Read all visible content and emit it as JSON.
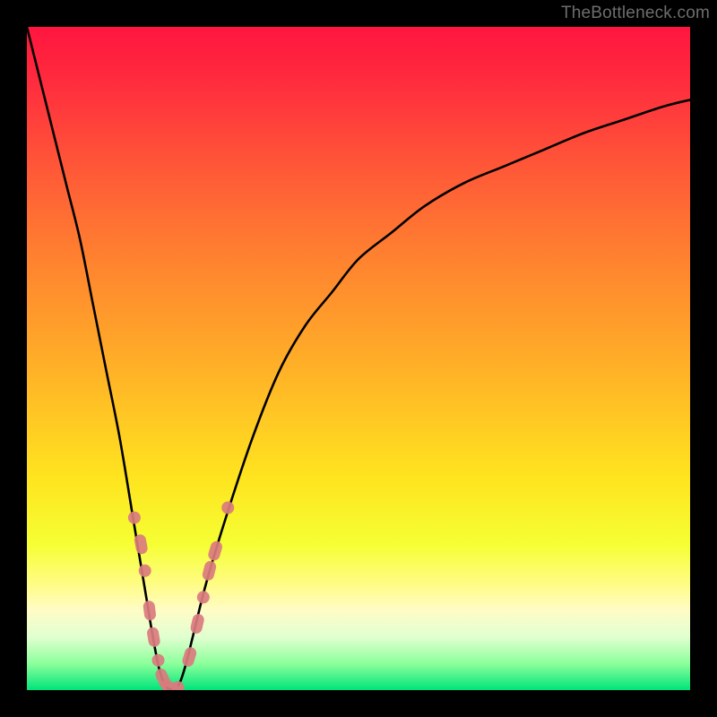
{
  "watermark": "TheBottleneck.com",
  "chart_data": {
    "type": "line",
    "title": "",
    "xlabel": "",
    "ylabel": "",
    "xlim": [
      0,
      100
    ],
    "ylim": [
      0,
      100
    ],
    "grid": false,
    "series": [
      {
        "name": "bottleneck-curve",
        "x": [
          0,
          2,
          4,
          6,
          8,
          10,
          12,
          14,
          16,
          17,
          18,
          19,
          20,
          21,
          22,
          23,
          24,
          25,
          27,
          30,
          34,
          38,
          42,
          46,
          50,
          55,
          60,
          66,
          72,
          78,
          84,
          90,
          96,
          100
        ],
        "y": [
          100,
          92,
          84,
          76,
          68,
          58,
          48,
          38,
          26,
          20,
          14,
          8,
          3,
          0.5,
          0.2,
          1,
          4,
          8,
          16,
          26,
          38,
          48,
          55,
          60,
          65,
          69,
          73,
          76.5,
          79,
          81.5,
          84,
          86,
          88,
          89
        ]
      }
    ],
    "scatter_points": {
      "name": "highlighted-points",
      "points": [
        {
          "x": 16.2,
          "y": 26.0
        },
        {
          "x": 17.2,
          "y": 22.0
        },
        {
          "x": 17.8,
          "y": 18.0
        },
        {
          "x": 18.5,
          "y": 12.0
        },
        {
          "x": 19.1,
          "y": 8.0
        },
        {
          "x": 19.8,
          "y": 4.5
        },
        {
          "x": 20.5,
          "y": 1.8
        },
        {
          "x": 21.6,
          "y": 0.4
        },
        {
          "x": 22.8,
          "y": 0.4
        },
        {
          "x": 24.5,
          "y": 5.0
        },
        {
          "x": 25.7,
          "y": 10.0
        },
        {
          "x": 26.6,
          "y": 14.0
        },
        {
          "x": 27.5,
          "y": 18.0
        },
        {
          "x": 28.4,
          "y": 21.0
        },
        {
          "x": 30.3,
          "y": 27.5
        }
      ]
    }
  }
}
